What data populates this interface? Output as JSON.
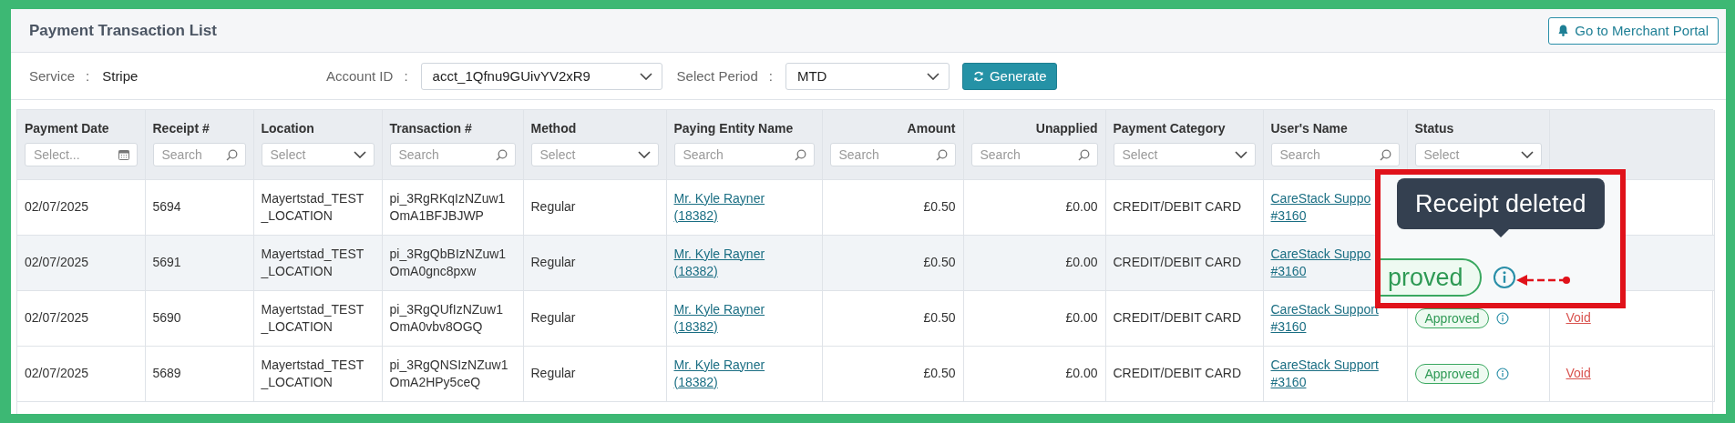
{
  "header": {
    "title": "Payment Transaction List",
    "portal_button": "Go to Merchant Portal"
  },
  "filters": [
    {
      "kind": "text",
      "label": "Service",
      "separator": ":",
      "value": "Stripe"
    },
    {
      "kind": "select",
      "label": "Account ID",
      "separator": ":",
      "value": "acct_1Qfnu9GUivYV2xR9"
    },
    {
      "kind": "select",
      "label": "Select Period",
      "separator": ":",
      "value": "MTD"
    }
  ],
  "generate_button": "Generate",
  "table": {
    "columns": [
      {
        "label": "Payment Date",
        "numeric": false,
        "filter": {
          "kind": "date",
          "placeholder": "Select..."
        }
      },
      {
        "label": "Receipt #",
        "numeric": false,
        "filter": {
          "kind": "search",
          "placeholder": "Search"
        }
      },
      {
        "label": "Location",
        "numeric": false,
        "filter": {
          "kind": "select",
          "placeholder": "Select"
        }
      },
      {
        "label": "Transaction #",
        "numeric": false,
        "filter": {
          "kind": "search",
          "placeholder": "Search"
        }
      },
      {
        "label": "Method",
        "numeric": false,
        "filter": {
          "kind": "select",
          "placeholder": "Select"
        }
      },
      {
        "label": "Paying Entity Name",
        "numeric": false,
        "filter": {
          "kind": "search",
          "placeholder": "Search"
        }
      },
      {
        "label": "Amount",
        "numeric": true,
        "filter": {
          "kind": "search",
          "placeholder": "Search"
        }
      },
      {
        "label": "Unapplied",
        "numeric": true,
        "filter": {
          "kind": "search",
          "placeholder": "Search"
        }
      },
      {
        "label": "Payment Category",
        "numeric": false,
        "filter": {
          "kind": "select",
          "placeholder": "Select"
        }
      },
      {
        "label": "User's Name",
        "numeric": false,
        "filter": {
          "kind": "search",
          "placeholder": "Search"
        }
      },
      {
        "label": "Status",
        "numeric": false,
        "filter": {
          "kind": "select",
          "placeholder": "Select"
        }
      }
    ],
    "rows": [
      {
        "payment_date": "02/07/2025",
        "receipt": "5694",
        "location": "Mayertstad_TEST\n_LOCATION",
        "transaction": "pi_3RgRKqIzNZuw1\nOmA1BFJBJWP",
        "method": "Regular",
        "paying_entity": "Mr. Kyle Rayner (18382)",
        "amount": "£0.50",
        "unapplied": "£0.00",
        "category": "CREDIT/DEBIT CARD",
        "user": "CareStack Suppo\n#3160",
        "selected": false
      },
      {
        "payment_date": "02/07/2025",
        "receipt": "5691",
        "location": "Mayertstad_TEST\n_LOCATION",
        "transaction": "pi_3RgQbBIzNZuw1\nOmA0gnc8pxw",
        "method": "Regular",
        "paying_entity": "Mr. Kyle Rayner (18382)",
        "amount": "£0.50",
        "unapplied": "£0.00",
        "category": "CREDIT/DEBIT CARD",
        "user": "CareStack Suppo\n#3160",
        "selected": true
      },
      {
        "payment_date": "02/07/2025",
        "receipt": "5690",
        "location": "Mayertstad_TEST\n_LOCATION",
        "transaction": "pi_3RgQUfIzNZuw1\nOmA0vbv8OGQ",
        "method": "Regular",
        "paying_entity": "Mr. Kyle Rayner (18382)",
        "amount": "£0.50",
        "unapplied": "£0.00",
        "category": "CREDIT/DEBIT CARD",
        "user": "CareStack Support\n#3160",
        "status": "Approved",
        "action": "Void",
        "selected": false
      },
      {
        "payment_date": "02/07/2025",
        "receipt": "5689",
        "location": "Mayertstad_TEST\n_LOCATION",
        "transaction": "pi_3RgQNSIzNZuw1\nOmA2HPy5ceQ",
        "method": "Regular",
        "paying_entity": "Mr. Kyle Rayner (18382)",
        "amount": "£0.50",
        "unapplied": "£0.00",
        "category": "CREDIT/DEBIT CARD",
        "user": "CareStack Support\n#3160",
        "status": "Approved",
        "action": "Void",
        "selected": false
      }
    ]
  },
  "callout": {
    "tooltip": "Receipt deleted",
    "status": "proved"
  }
}
